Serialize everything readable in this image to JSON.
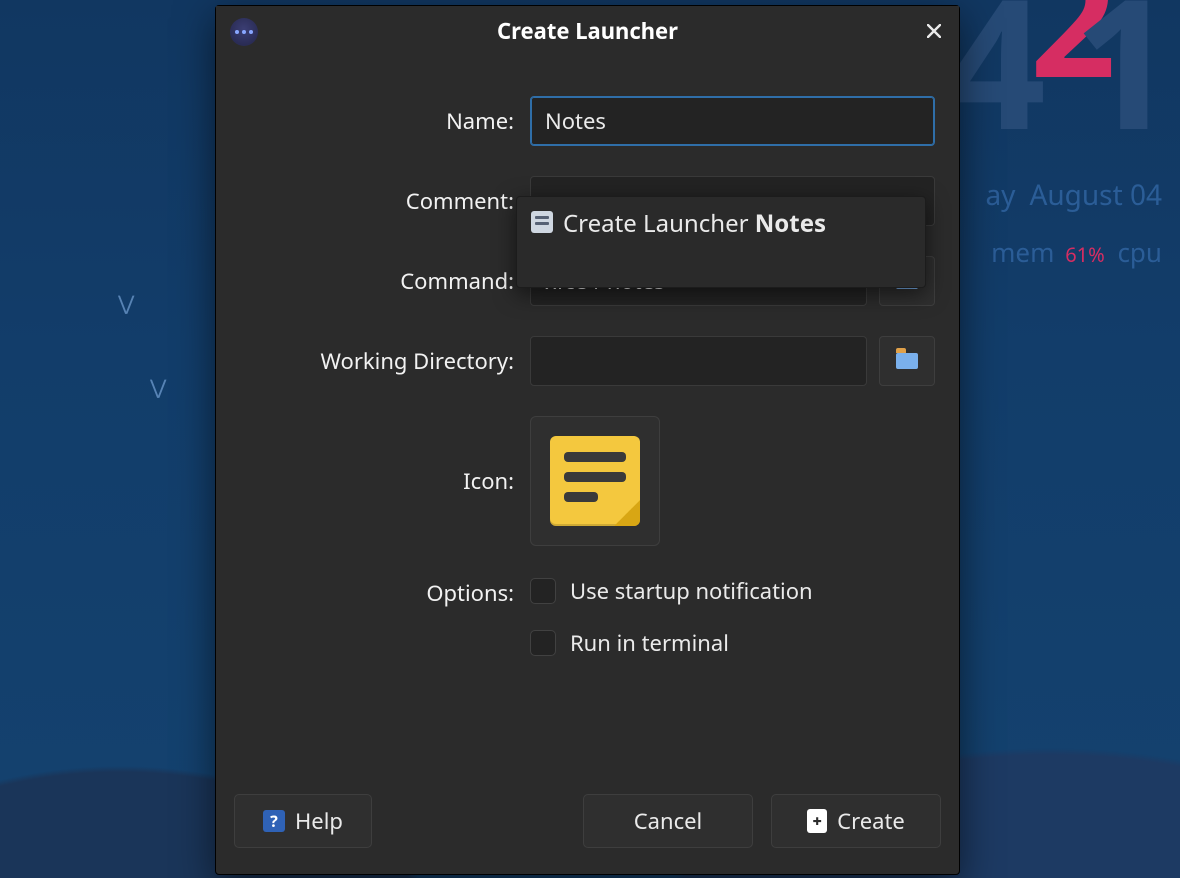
{
  "desktop": {
    "clock": {
      "hour_tens": "4",
      "hour_overlay": "2",
      "hour_ones": "1"
    },
    "date": {
      "weekday_visible": "ay",
      "rest": "August 04"
    },
    "stats": {
      "mem_label": "mem",
      "mem_pct": "61%",
      "cpu_label": "cpu"
    }
  },
  "dialog": {
    "title": "Create Launcher",
    "labels": {
      "name": "Name:",
      "comment": "Comment:",
      "command": "Command:",
      "working_dir": "Working Directory:",
      "icon": "Icon:",
      "options": "Options:"
    },
    "fields": {
      "name": "Notes",
      "comment": "",
      "command": "xfce4-notes",
      "working_dir": ""
    },
    "options": {
      "startup_notification": {
        "label": "Use startup notification",
        "checked": false
      },
      "run_in_terminal": {
        "label": "Run in terminal",
        "checked": false
      }
    },
    "suggestion": {
      "prefix": "Create Launcher ",
      "match": "Notes"
    },
    "buttons": {
      "help": "Help",
      "cancel": "Cancel",
      "create": "Create"
    }
  }
}
